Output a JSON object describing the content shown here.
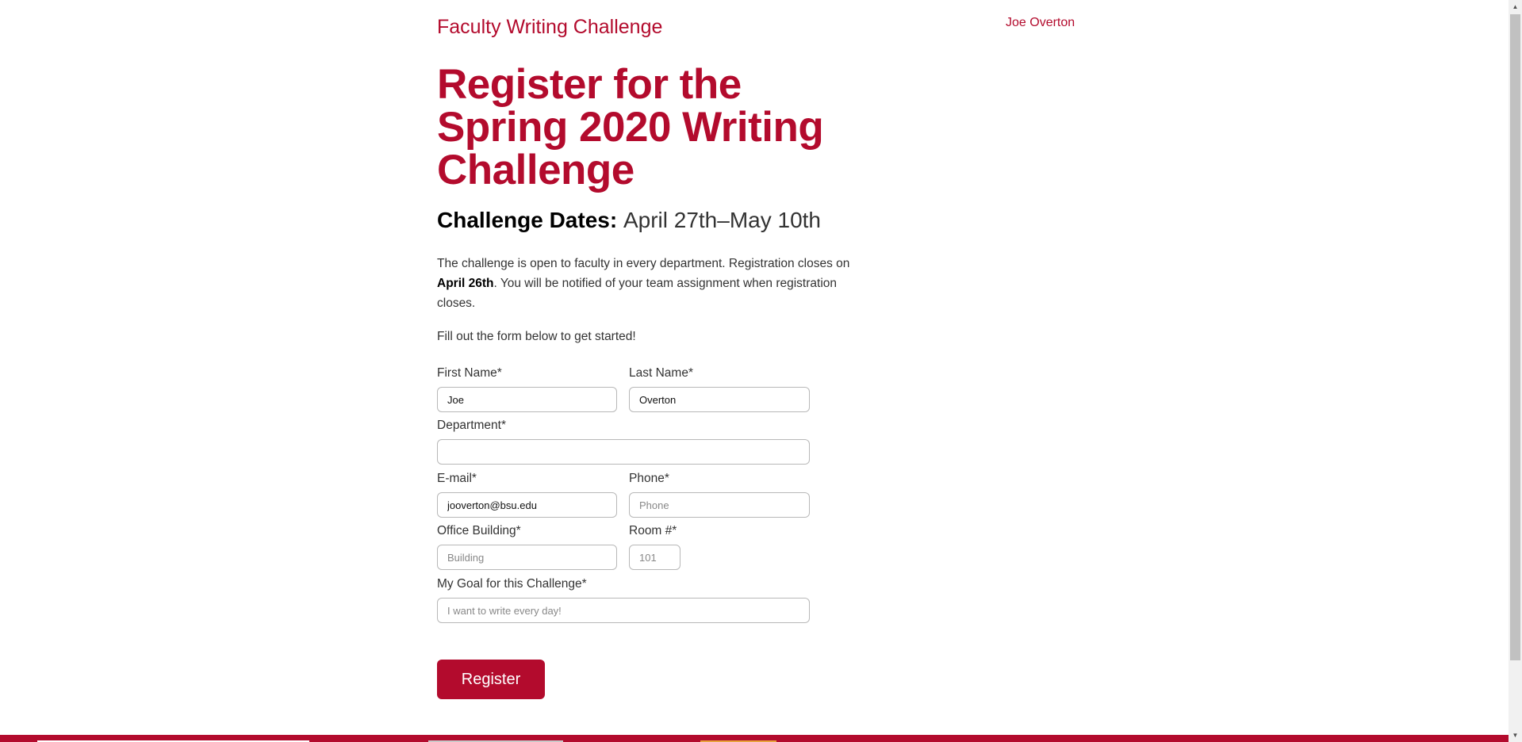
{
  "header": {
    "site_title": "Faculty Writing Challenge",
    "user_name": "Joe Overton"
  },
  "main": {
    "heading": "Register for the Spring 2020 Writing Challenge",
    "dates_label": "Challenge Dates:",
    "dates_value": "April 27th–May 10th",
    "intro_part1": "The challenge is open to faculty in every department. Registration closes on ",
    "intro_bold": "April 26th",
    "intro_part2": ". You will be notified of your team assignment when registration closes.",
    "cta": "Fill out the form below to get started!"
  },
  "form": {
    "first_name": {
      "label": "First Name*",
      "value": "Joe",
      "placeholder": ""
    },
    "last_name": {
      "label": "Last Name*",
      "value": "Overton",
      "placeholder": ""
    },
    "department": {
      "label": "Department*",
      "value": "",
      "placeholder": ""
    },
    "email": {
      "label": "E-mail*",
      "value": "jooverton@bsu.edu",
      "placeholder": ""
    },
    "phone": {
      "label": "Phone*",
      "value": "",
      "placeholder": "Phone"
    },
    "building": {
      "label": "Office Building*",
      "value": "",
      "placeholder": "Building"
    },
    "room": {
      "label": "Room #*",
      "value": "",
      "placeholder": "101"
    },
    "goal": {
      "label": "My Goal for this Challenge*",
      "value": "",
      "placeholder": "I want to write every day!"
    },
    "submit_label": "Register"
  },
  "colors": {
    "accent": "#b30b2d",
    "text": "#333333",
    "field_border": "#b8b8b8"
  }
}
